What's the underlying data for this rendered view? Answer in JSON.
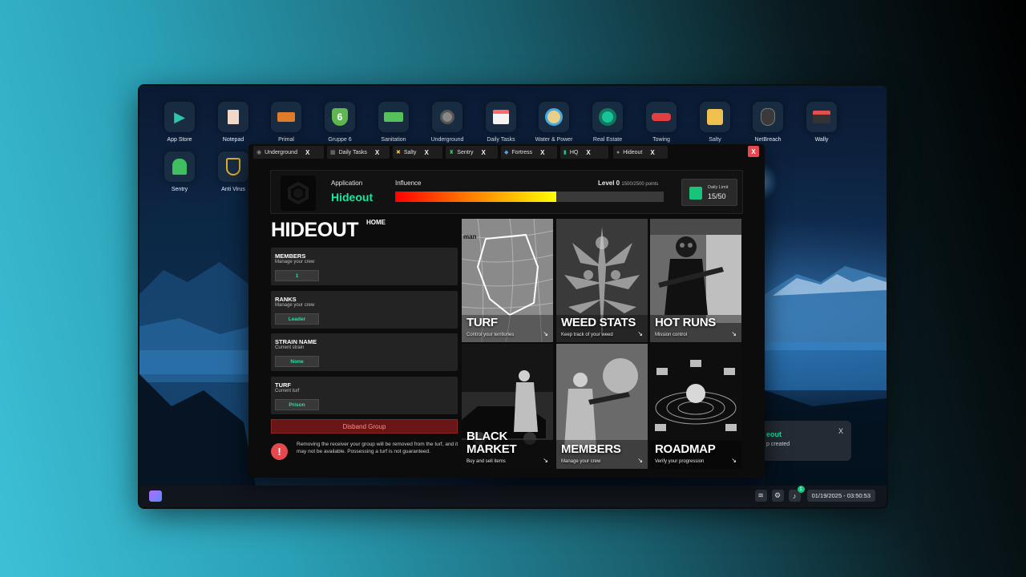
{
  "desktop": {
    "icons": [
      {
        "label": "App Store",
        "icon": "play-store-icon",
        "glyph": "▶",
        "color": "#2ec4a8"
      },
      {
        "label": "Notepad",
        "icon": "notepad-icon",
        "glyph": "▯",
        "color": "#f1d8c9"
      },
      {
        "label": "Primal",
        "icon": "truck-icon",
        "glyph": "🚚",
        "color": "#e07b2a"
      },
      {
        "label": "Gruppe 6",
        "icon": "shield-icon",
        "glyph": "6",
        "color": "#7bd66a"
      },
      {
        "label": "Sanitation",
        "icon": "garbage-truck-icon",
        "glyph": "🚛",
        "color": "#56c05a"
      },
      {
        "label": "Underground",
        "icon": "underground-icon",
        "glyph": "◉",
        "color": "#9a9a9a"
      },
      {
        "label": "Daily Tasks",
        "icon": "calendar-icon",
        "glyph": "📅",
        "color": "#ff6b6b"
      },
      {
        "label": "Water & Power",
        "icon": "water-power-icon",
        "glyph": "◎",
        "color": "#4aa8e0"
      },
      {
        "label": "Real Estate",
        "icon": "real-estate-icon",
        "glyph": "⌂",
        "color": "#19c39a"
      },
      {
        "label": "Towing",
        "icon": "tow-truck-icon",
        "glyph": "🚗",
        "color": "#e04040"
      },
      {
        "label": "Salty",
        "icon": "salty-icon",
        "glyph": "✖",
        "color": "#f0c050"
      },
      {
        "label": "NetBreach",
        "icon": "mask-icon",
        "glyph": "☻",
        "color": "#c0c0c0"
      },
      {
        "label": "Wally",
        "icon": "wallet-icon",
        "glyph": "▣",
        "color": "#e05050"
      },
      {
        "label": "Sentry",
        "icon": "sentry-icon",
        "glyph": "♜",
        "color": "#3fbf5f"
      },
      {
        "label": "Anti Virus",
        "icon": "antivirus-shield-icon",
        "glyph": "⛨",
        "color": "#e0b030"
      }
    ],
    "notification": {
      "title": "eout",
      "subtitle": "p created",
      "close": "X"
    },
    "taskbar": {
      "time": "01/19/2025 - 03:50:53",
      "badge": "1"
    }
  },
  "window": {
    "tabs": [
      {
        "label": "Underground",
        "close": "X"
      },
      {
        "label": "Daily Tasks",
        "close": "X"
      },
      {
        "label": "Salty",
        "close": "X"
      },
      {
        "label": "Sentry",
        "close": "X"
      },
      {
        "label": "Fortress",
        "close": "X"
      },
      {
        "label": "HQ",
        "close": "X"
      },
      {
        "label": "Hideout",
        "close": "X"
      }
    ],
    "close": "X"
  },
  "header": {
    "app_label": "Application",
    "app_name": "Hideout",
    "influence_label": "Influence",
    "level_label": "Level 0",
    "level_points": "1500/2500 points",
    "influence_progress": 0.6,
    "daily_limit_label": "Daily Limit",
    "daily_limit_value": "15/50"
  },
  "main": {
    "title": "HIDEOUT",
    "home": "HOME",
    "cards": [
      {
        "title": "MEMBERS",
        "subtitle": "Manage your crew",
        "value": "1"
      },
      {
        "title": "RANKS",
        "subtitle": "Manage your crew",
        "value": "Leader"
      },
      {
        "title": "STRAIN NAME",
        "subtitle": "Current strain",
        "value": "None"
      },
      {
        "title": "TURF",
        "subtitle": "Current turf",
        "value": "Prison"
      }
    ],
    "disband": "Disband Group",
    "warning": "Removing the receiver your group will be removed from the turf, and it may not be available. Possessing a turf is not guaranteed.",
    "tiles": [
      {
        "title": "TURF",
        "subtitle": "Control your territories"
      },
      {
        "title": "WEED STATS",
        "subtitle": "Keep track of your weed"
      },
      {
        "title": "HOT RUNS",
        "subtitle": "Mission control"
      },
      {
        "title": "BLACK MARKET",
        "title_line1": "BLACK",
        "title_line2": "MARKET",
        "subtitle": "Buy and sell items"
      },
      {
        "title": "MEMBERS",
        "subtitle": "Manage your crew"
      },
      {
        "title": "ROADMAP",
        "subtitle": "Verify your progression"
      }
    ],
    "map_text": "man"
  }
}
